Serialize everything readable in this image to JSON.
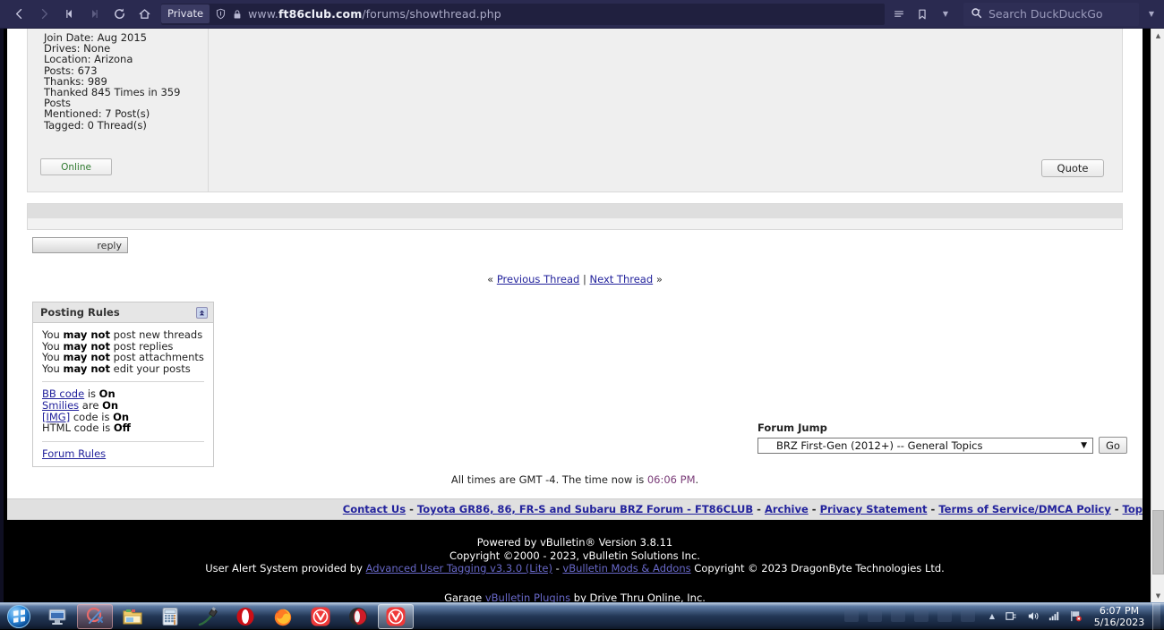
{
  "browser": {
    "nav": {
      "back": "back-arrow",
      "forward": "forward-arrow",
      "rewind": "rewind",
      "fastforward": "fastforward",
      "reload": "reload",
      "home": "home"
    },
    "private_label": "Private",
    "url_prefix": "www.",
    "url_domain": "ft86club.com",
    "url_path": "/forums/showthread.php",
    "search_placeholder": "Search DuckDuckGo"
  },
  "post": {
    "user_info": [
      "Join Date: Aug 2015",
      "Drives: None",
      "Location: Arizona",
      "Posts: 673",
      "Thanks: 989",
      "Thanked 845 Times in 359",
      "Posts",
      "Mentioned: 7 Post(s)",
      "Tagged: 0 Thread(s)"
    ],
    "online_label": "Online",
    "quote_label": "Quote"
  },
  "reply_button_label": "reply",
  "thread_nav": {
    "prev_arrow": "«",
    "prev_label": "Previous Thread",
    "separator": "|",
    "next_label": "Next Thread",
    "next_arrow": "»"
  },
  "posting_rules": {
    "title": "Posting Rules",
    "collapse_icon": "collapse-icon",
    "rules": [
      {
        "pre": "You ",
        "strong": "may not",
        "post": " post new threads"
      },
      {
        "pre": "You ",
        "strong": "may not",
        "post": " post replies"
      },
      {
        "pre": "You ",
        "strong": "may not",
        "post": " post attachments"
      },
      {
        "pre": "You ",
        "strong": "may not",
        "post": " edit your posts"
      }
    ],
    "codes": [
      {
        "link": "BB code",
        "mid": " is ",
        "state": "On"
      },
      {
        "link": "Smilies",
        "mid": " are ",
        "state": "On"
      },
      {
        "link": "[IMG]",
        "mid": " code is ",
        "state": "On"
      },
      {
        "link": "HTML code",
        "mid": " is ",
        "state": "Off",
        "plain": true
      }
    ],
    "forum_rules_label": "Forum Rules"
  },
  "forum_jump": {
    "label": "Forum Jump",
    "selected": "BRZ First-Gen (2012+) -- General Topics",
    "go_label": "Go"
  },
  "times": {
    "prefix": "All times are GMT -4. The time now is ",
    "clock": "06:06 PM",
    "suffix": "."
  },
  "footer_links": [
    "Contact Us",
    "Toyota GR86, 86, FR-S and Subaru BRZ Forum - FT86CLUB",
    "Archive",
    "Privacy Statement",
    "Terms of Service/DMCA Policy",
    "Top"
  ],
  "footer_separator": "-",
  "copyright": {
    "line1": "Powered by vBulletin® Version 3.8.11",
    "line2": "Copyright ©2000 - 2023, vBulletin Solutions Inc.",
    "line3_pre": "User Alert System provided by ",
    "line3_link1": "Advanced User Tagging v3.3.0 (Lite)",
    "line3_mid": " - ",
    "line3_link2": "vBulletin Mods & Addons",
    "line3_post": " Copyright © 2023 DragonByte Technologies Ltd.",
    "garage_pre": "Garage ",
    "garage_link": "vBulletin Plugins",
    "garage_post": " by Drive Thru Online, Inc."
  },
  "taskbar": {
    "start": "windows-start-orb",
    "items": [
      {
        "name": "remote-desktop-icon",
        "active": false
      },
      {
        "name": "snipping-tool-icon",
        "active": false,
        "highlight": true
      },
      {
        "name": "windows-explorer-icon",
        "active": false
      },
      {
        "name": "calculator-icon",
        "active": false
      },
      {
        "name": "usb-cable-icon",
        "active": false
      },
      {
        "name": "opera-browser-icon",
        "active": false
      },
      {
        "name": "firefox-browser-icon",
        "active": false
      },
      {
        "name": "vivaldi-browser-icon",
        "active": false
      },
      {
        "name": "opera-gx-browser-icon",
        "active": false
      },
      {
        "name": "vivaldi-browser-window-icon",
        "active": true
      }
    ],
    "tray": {
      "show_hidden": "show-hidden-icons-arrow",
      "power": "power-plug-icon",
      "volume": "volume-icon",
      "network_signal": "network-signal-icon",
      "action_center": "action-center-flag-icon",
      "time": "6:07 PM",
      "date": "5/16/2023"
    }
  }
}
